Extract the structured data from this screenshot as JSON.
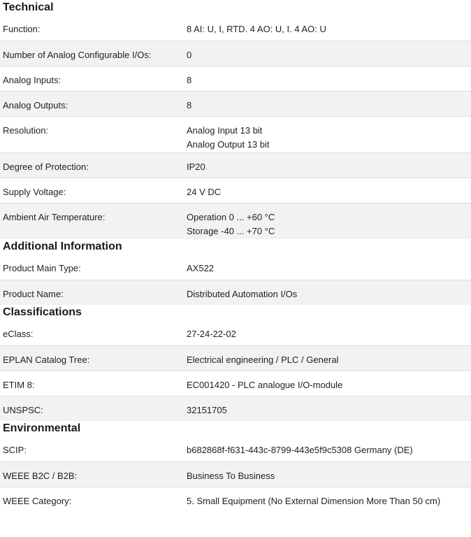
{
  "sections": [
    {
      "title": "Technical",
      "rows": [
        {
          "label": "Function:",
          "values": [
            "8 AI: U, I, RTD. 4 AO: U, I. 4 AO: U"
          ]
        },
        {
          "label": "Number of Analog Configurable I/Os:",
          "values": [
            "0"
          ]
        },
        {
          "label": "Analog Inputs:",
          "values": [
            "8"
          ]
        },
        {
          "label": "Analog Outputs:",
          "values": [
            "8"
          ]
        },
        {
          "label": "Resolution:",
          "values": [
            "Analog Input 13 bit",
            "Analog Output 13 bit"
          ]
        },
        {
          "label": "Degree of Protection:",
          "values": [
            "IP20"
          ]
        },
        {
          "label": "Supply Voltage:",
          "values": [
            "24 V DC"
          ]
        },
        {
          "label": "Ambient Air Temperature:",
          "values": [
            "Operation 0 ... +60 °C",
            "Storage -40 ... +70 °C"
          ]
        }
      ]
    },
    {
      "title": "Additional Information",
      "rows": [
        {
          "label": "Product Main Type:",
          "values": [
            "AX522"
          ]
        },
        {
          "label": "Product Name:",
          "values": [
            "Distributed Automation I/Os"
          ]
        }
      ]
    },
    {
      "title": "Classifications",
      "rows": [
        {
          "label": "eClass:",
          "values": [
            "27-24-22-02"
          ]
        },
        {
          "label": "EPLAN Catalog Tree:",
          "values": [
            "Electrical engineering / PLC / General"
          ]
        },
        {
          "label": "ETIM 8:",
          "values": [
            "EC001420 - PLC analogue I/O-module"
          ]
        },
        {
          "label": "UNSPSC:",
          "values": [
            "32151705"
          ]
        }
      ]
    },
    {
      "title": "Environmental",
      "rows": [
        {
          "label": "SCIP:",
          "values": [
            "b682868f-f631-443c-8799-443e5f9c5308 Germany (DE)"
          ]
        },
        {
          "label": "WEEE B2C / B2B:",
          "values": [
            "Business To Business"
          ]
        },
        {
          "label": "WEEE Category:",
          "values": [
            "5. Small Equipment (No External Dimension More Than 50 cm)"
          ]
        }
      ]
    }
  ]
}
